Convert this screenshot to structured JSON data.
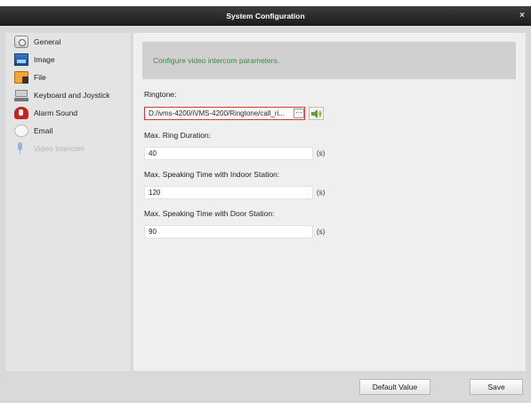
{
  "window": {
    "title": "System Configuration",
    "close_glyph": "×"
  },
  "sidebar": {
    "items": [
      {
        "label": "General",
        "icon": "general-icon",
        "enabled": true
      },
      {
        "label": "Image",
        "icon": "image-icon",
        "enabled": true
      },
      {
        "label": "File",
        "icon": "file-icon",
        "enabled": true
      },
      {
        "label": "Keyboard and Joystick",
        "icon": "keyboard-icon",
        "enabled": true
      },
      {
        "label": "Alarm Sound",
        "icon": "alarm-sound-icon",
        "enabled": true
      },
      {
        "label": "Email",
        "icon": "email-icon",
        "enabled": true
      },
      {
        "label": "Video Intercom",
        "icon": "intercom-icon",
        "enabled": false
      }
    ]
  },
  "main": {
    "banner": "Configure video intercom parameters.",
    "ringtone": {
      "label": "Ringtone:",
      "value": "D:/ivms-4200/iVMS-4200/Ringtone/call_ri...",
      "browse_label": "···"
    },
    "max_ring_duration": {
      "label": "Max. Ring Duration:",
      "value": "40",
      "unit": "(s)"
    },
    "max_speaking_indoor": {
      "label": "Max. Speaking Time with Indoor Station:",
      "value": "120",
      "unit": "(s)"
    },
    "max_speaking_door": {
      "label": "Max. Speaking Time with Door Station:",
      "value": "90",
      "unit": "(s)"
    }
  },
  "footer": {
    "default_label": "Default Value",
    "save_label": "Save"
  },
  "colors": {
    "titlebar": "#2a2a2a",
    "banner_text": "#3f8a3b",
    "ringtone_border": "#d23b3b"
  }
}
